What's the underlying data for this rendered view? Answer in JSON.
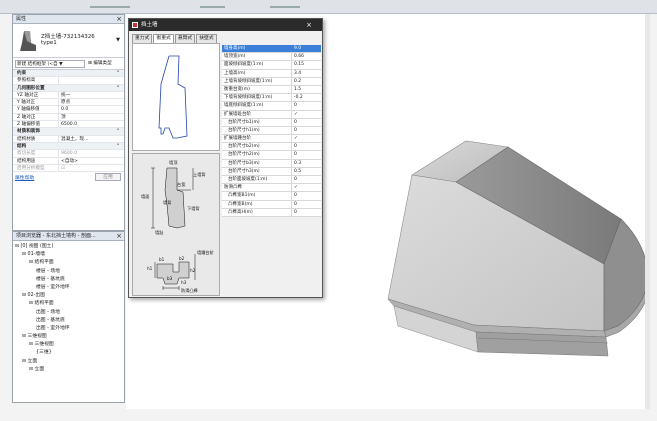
{
  "properties": {
    "title": "属性",
    "type_name": "Z挡土墙-732134326",
    "type_sub": "type1",
    "filter": "新建 结构框架 (<自 ▼",
    "edit_type": "编辑类型",
    "rows": [
      {
        "k": "约束",
        "v": "",
        "sect": true
      },
      {
        "k": "参照标高",
        "v": ""
      },
      {
        "k": "几何图形位置",
        "v": "",
        "sect": true
      },
      {
        "k": "YZ 轴对正",
        "v": "统一"
      },
      {
        "k": "Y 轴对正",
        "v": "原点"
      },
      {
        "k": "Y 轴偏移值",
        "v": "0.0"
      },
      {
        "k": "Z 轴对正",
        "v": "顶"
      },
      {
        "k": "Z 轴偏移值",
        "v": "6500.0"
      },
      {
        "k": "材质和装饰",
        "v": "",
        "sect": true
      },
      {
        "k": "结构材质",
        "v": "混凝土，现..."
      },
      {
        "k": "结构",
        "v": "",
        "sect": true
      },
      {
        "k": "剪切长度",
        "v": "9600.0",
        "gray": true
      },
      {
        "k": "结构用途",
        "v": "<自动>"
      },
      {
        "k": "启用分析模型",
        "v": "☑",
        "gray": true
      }
    ],
    "help_link": "属性帮助",
    "apply": "应用"
  },
  "browser": {
    "title": "项目浏览器 - 东北挡土墙构 - 剖面...",
    "items": [
      {
        "t": "⊟ [0] 视图 (图土)",
        "lvl": 0
      },
      {
        "t": "⊟ 01-墙墙",
        "lvl": 1
      },
      {
        "t": "⊟ 结构平面",
        "lvl": 2
      },
      {
        "t": "楼层 - 场地",
        "lvl": 3
      },
      {
        "t": "楼层 - 基坑底",
        "lvl": 3
      },
      {
        "t": "楼层 - 室外地坪",
        "lvl": 3
      },
      {
        "t": "⊟ 02-出图",
        "lvl": 1
      },
      {
        "t": "⊟ 结构平面",
        "lvl": 2
      },
      {
        "t": "出图 - 场地",
        "lvl": 3
      },
      {
        "t": "出图 - 基坑底",
        "lvl": 3
      },
      {
        "t": "出图 - 室外地坪",
        "lvl": 3
      },
      {
        "t": "⊟ 三维视图",
        "lvl": 1
      },
      {
        "t": "⊟ 三维视图",
        "lvl": 2
      },
      {
        "t": "{三维}",
        "lvl": 3
      },
      {
        "t": "⊟ 立面",
        "lvl": 1
      },
      {
        "t": "⊟ 立面",
        "lvl": 2
      }
    ]
  },
  "dialog": {
    "title": "挡土墙",
    "close": "×",
    "tabs": [
      "重力式",
      "衡重式",
      "悬臂式",
      "扶壁式"
    ],
    "active_tab": 1,
    "rows": [
      {
        "k": "墙身高(m)",
        "v": "9.0",
        "sel": true
      },
      {
        "k": "墙顶宽(m)",
        "v": "0.66"
      },
      {
        "k": "面坡倾斜坡度(1:m)",
        "v": "0.15"
      },
      {
        "k": "上墙高(m)",
        "v": "3.4"
      },
      {
        "k": "上墙背坡倾斜坡度(1:m)",
        "v": "0.2"
      },
      {
        "k": "衡重台宽(m)",
        "v": "1.5"
      },
      {
        "k": "下墙背坡倾斜坡度(1:m)",
        "v": "-0.2"
      },
      {
        "k": "墙底倾斜坡度(1:m)",
        "v": "0"
      },
      {
        "k": "扩展墙趾台阶",
        "v": "✓"
      },
      {
        "k": "台阶尺寸b1(m)",
        "v": "0",
        "ind": true
      },
      {
        "k": "台阶尺寸h1(m)",
        "v": "0",
        "ind": true
      },
      {
        "k": "扩展墙踵台阶",
        "v": "✓"
      },
      {
        "k": "台阶尺寸b2(m)",
        "v": "0",
        "ind": true
      },
      {
        "k": "台阶尺寸h2(m)",
        "v": "0",
        "ind": true
      },
      {
        "k": "台阶尺寸b3(m)",
        "v": "0.3",
        "ind": true
      },
      {
        "k": "台阶尺寸h3(m)",
        "v": "0.5",
        "ind": true
      },
      {
        "k": "台阶面坡坡度(1:m)",
        "v": "0",
        "ind": true
      },
      {
        "k": "防滑凸榫",
        "v": "✓"
      },
      {
        "k": "凸榫宽B1(m)",
        "v": "0",
        "ind": true
      },
      {
        "k": "凸榫宽B(m)",
        "v": "0",
        "ind": true
      },
      {
        "k": "凸榫高H(m)",
        "v": "0",
        "ind": true
      }
    ],
    "diagram_labels": {
      "wall_top": "墙顶",
      "upper_wall": "上墙背",
      "platform": "台宽",
      "wall_face": "墙面",
      "wall_heel_face": "墙背",
      "lower_back": "下墙背",
      "toe": "墙趾",
      "heel": "墙踵台阶",
      "bottom": "防滑凸榫",
      "b1": "b1",
      "h1": "h1",
      "b2": "b2",
      "h2": "h2",
      "b3": "b3",
      "h3": "h3"
    }
  },
  "colors": {
    "selection": "#3b7fd8",
    "dialog_title": "#2b2b2b"
  }
}
